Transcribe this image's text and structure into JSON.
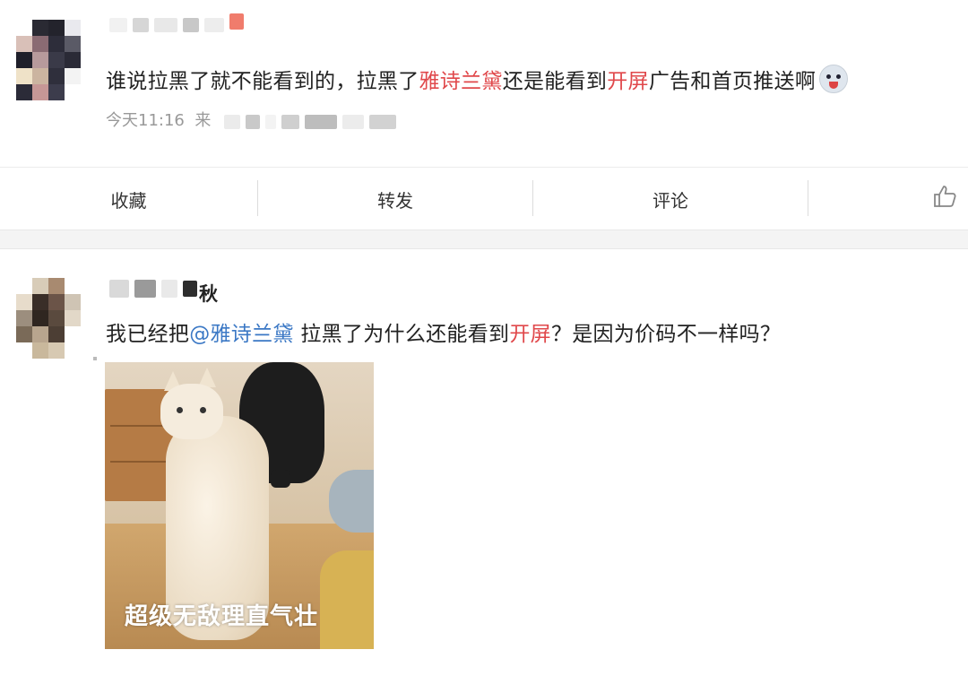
{
  "post1": {
    "text_pre": "谁说拉黑了就不能看到的，拉黑了",
    "brand": "雅诗兰黛",
    "text_mid": "还是能看到",
    "kw_open": "开屏",
    "text_post": "广告和首页推送啊",
    "emoji_icon": "husky-emoji-icon",
    "time": "今天11:16",
    "source_prefix": "来"
  },
  "actions": {
    "favorite": "收藏",
    "repost": "转发",
    "comment": "评论",
    "like_icon": "thumbs-up-icon"
  },
  "post2": {
    "name_suffix": "秋",
    "text_pre": "我已经把",
    "mention": "@雅诗兰黛",
    "text_mid": " 拉黑了为什么还能看到",
    "kw_open": "开屏",
    "text_post": "？是因为价码不一样吗？",
    "image_caption": "超级无敌理直气壮"
  },
  "colors": {
    "keyword": "#e0484b",
    "mention": "#3b78c5",
    "meta": "#999999"
  }
}
